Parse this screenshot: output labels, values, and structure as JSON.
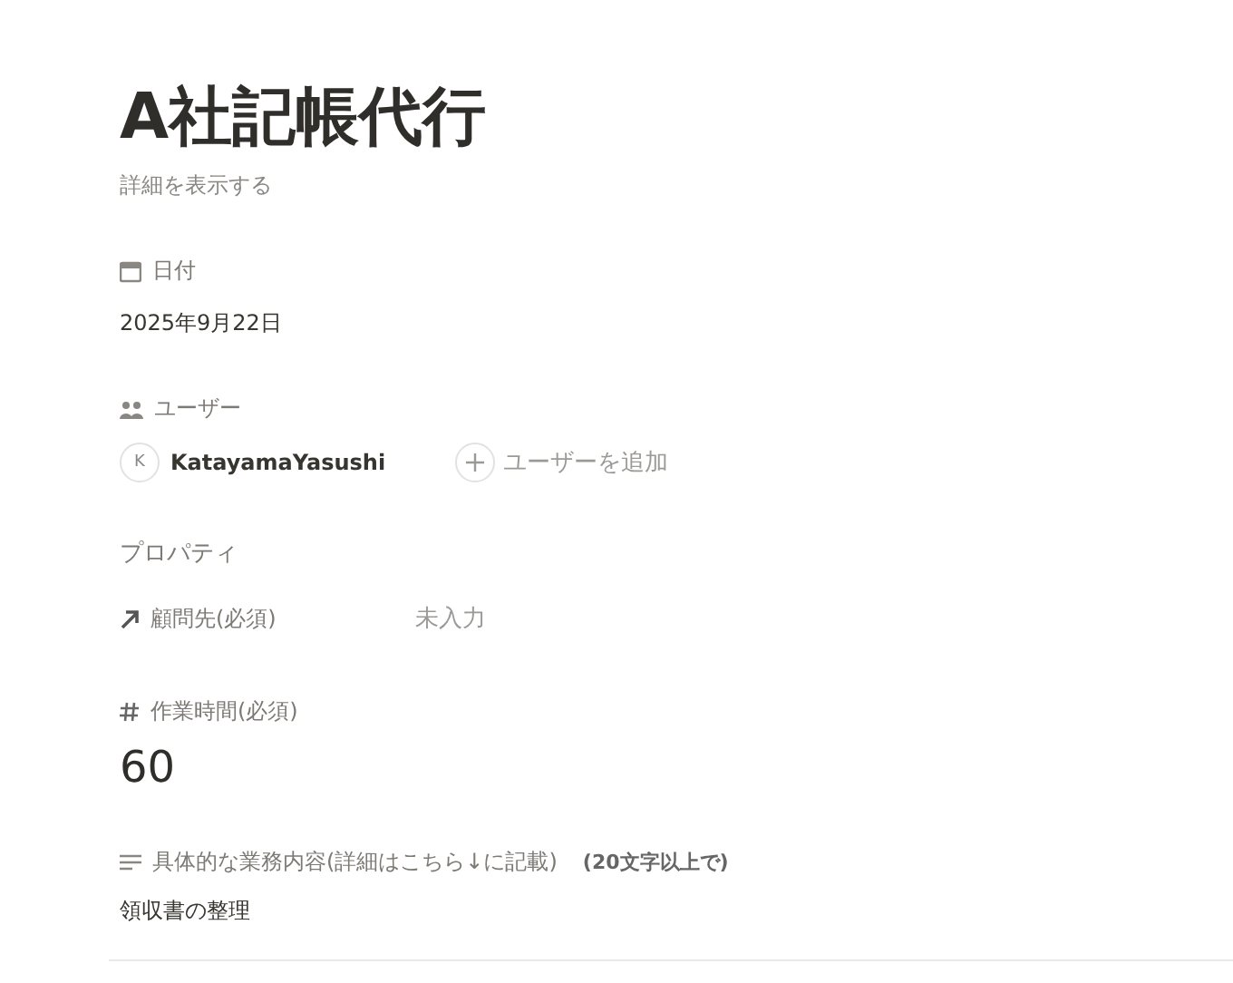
{
  "title": "A社記帳代行",
  "details_link": "詳細を表示する",
  "date": {
    "label": "日付",
    "value": "2025年9月22日"
  },
  "users": {
    "label": "ユーザー",
    "people": [
      {
        "initial": "K",
        "name": "KatayamaYasushi"
      }
    ],
    "add_label": "ユーザーを追加"
  },
  "properties": {
    "heading": "プロパティ",
    "fields": [
      {
        "kind": "relation",
        "label": "顧問先(必須)",
        "placeholder": "未入力"
      },
      {
        "kind": "number",
        "label": "作業時間(必須)",
        "value": "60"
      },
      {
        "kind": "text",
        "label": "具体的な業務内容(詳細はこちら↓に記載)",
        "note": "(20文字以上で)",
        "value": "領収書の整理"
      }
    ]
  }
}
